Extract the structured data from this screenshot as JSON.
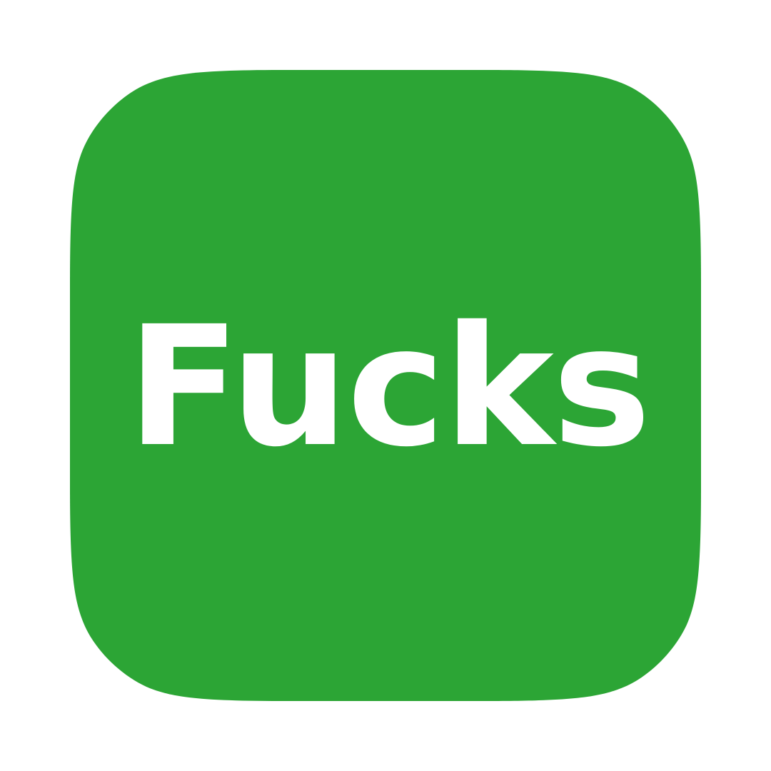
{
  "icon": {
    "text": "Fucks",
    "background_color": "#2ca535",
    "text_color": "#ffffff",
    "page_color": "#ffffff"
  }
}
